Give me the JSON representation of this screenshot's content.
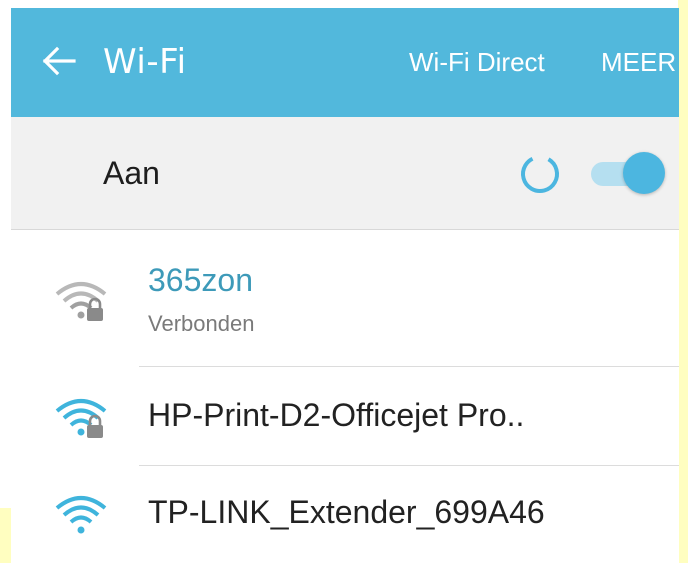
{
  "app_bar": {
    "title": "Wi-Fi",
    "actions": {
      "wifi_direct": "Wi-Fi Direct",
      "more": "MEER"
    },
    "back_icon": "arrow-left-icon"
  },
  "master_switch": {
    "label": "Aan",
    "state": "on",
    "scanning": true
  },
  "networks": [
    {
      "ssid": "365zon",
      "status": "Verbonden",
      "connected": true,
      "secured": true,
      "signal_icon": "wifi-lock-icon"
    },
    {
      "ssid": "HP-Print-D2-Officejet Pro..",
      "status": "",
      "connected": false,
      "secured": true,
      "signal_icon": "wifi-lock-icon"
    },
    {
      "ssid": "TP-LINK_Extender_699A46",
      "status": "",
      "connected": false,
      "secured": false,
      "signal_icon": "wifi-icon"
    }
  ],
  "colors": {
    "app_bar": "#52b8dc",
    "accent": "#4cb6e0",
    "connected_ssid": "#3d9ab9",
    "wifi_icon_active": "#3fb4dc",
    "wifi_icon_connected": "#a9a9a9"
  }
}
